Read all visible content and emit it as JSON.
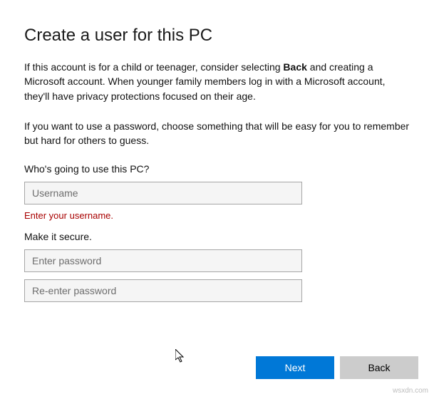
{
  "header": {
    "title": "Create a user for this PC"
  },
  "paragraphs": {
    "p1_before": "If this account is for a child or teenager, consider selecting ",
    "p1_bold": "Back",
    "p1_after": " and creating a Microsoft account. When younger family members log in with a Microsoft account, they'll have privacy protections focused on their age.",
    "p2": "If you want to use a password, choose something that will be easy for you to remember but hard for others to guess."
  },
  "form": {
    "who_label": "Who's going to use this PC?",
    "username_placeholder": "Username",
    "username_value": "",
    "error_username": "Enter your username.",
    "secure_label": "Make it secure.",
    "password_placeholder": "Enter password",
    "password_value": "",
    "reenter_placeholder": "Re-enter password",
    "reenter_value": ""
  },
  "buttons": {
    "next": "Next",
    "back": "Back"
  },
  "watermark": "wsxdn.com"
}
